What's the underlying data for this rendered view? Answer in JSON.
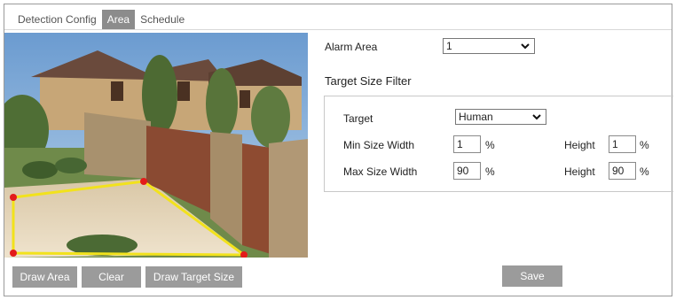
{
  "tabs": [
    {
      "label": "Detection Config",
      "active": false
    },
    {
      "label": "Area",
      "active": true
    },
    {
      "label": "Schedule",
      "active": false
    }
  ],
  "alarm_area": {
    "label": "Alarm Area",
    "value": "1"
  },
  "target_size_filter": {
    "title": "Target Size Filter",
    "target": {
      "label": "Target",
      "value": "Human"
    },
    "min": {
      "width_label": "Min Size Width",
      "width_value": "1",
      "width_unit": "%",
      "height_label": "Height",
      "height_value": "1",
      "height_unit": "%"
    },
    "max": {
      "width_label": "Max Size Width",
      "width_value": "90",
      "width_unit": "%",
      "height_label": "Height",
      "height_value": "90",
      "height_unit": "%"
    }
  },
  "buttons": {
    "draw_area": "Draw Area",
    "clear": "Clear",
    "draw_target_size": "Draw Target Size",
    "save": "Save"
  },
  "colors": {
    "button_bg": "#9b9b9b",
    "active_tab": "#8c8c8c",
    "area_line": "#f2e21c",
    "area_point": "#e31b1b"
  },
  "icons": {
    "dropdown": "chevron-down-icon"
  }
}
